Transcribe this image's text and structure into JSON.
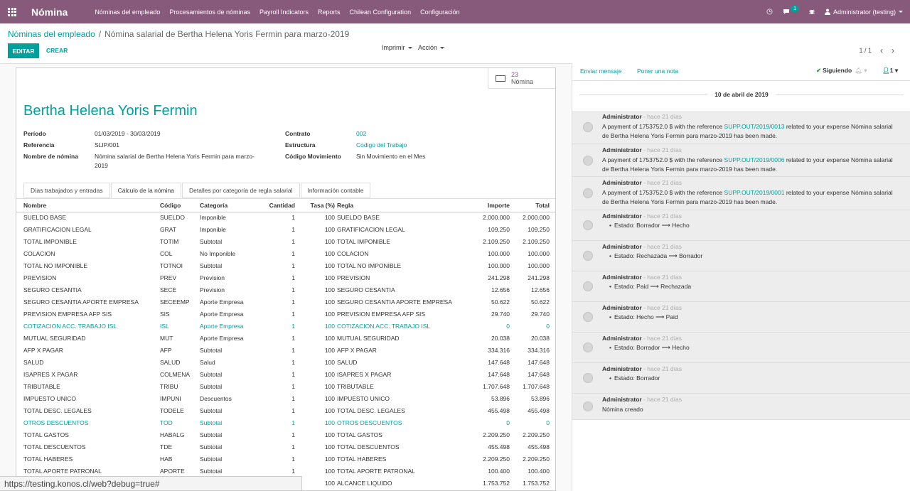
{
  "topbar": {
    "app_title": "Nómina",
    "menu": [
      "Nóminas del empleado",
      "Procesamientos de nóminas",
      "Payroll Indicators",
      "Reports",
      "Chilean Configuration",
      "Configuración"
    ],
    "message_count": "1",
    "user": "Administrator (testing)"
  },
  "breadcrumb": {
    "parent": "Nóminas del empleado",
    "separator": "/",
    "current": "Nómina salarial de Bertha Helena Yoris Fermin para marzo-2019"
  },
  "actions": {
    "edit": "EDITAR",
    "create": "CREAR",
    "print": "Imprimir",
    "action": "Acción",
    "pager": "1 / 1"
  },
  "smart_button": {
    "count": "23",
    "label": "Nómina"
  },
  "form": {
    "employee": "Bertha Helena Yoris Fermin",
    "period_label": "Período",
    "period": "01/03/2019 - 30/03/2019",
    "reference_label": "Referencia",
    "reference": "SLIP/001",
    "name_label": "Nombre de nómina",
    "name_line1": "Nómina salarial de Bertha Helena Yoris Fermin para marzo-",
    "name_line2": "2019",
    "contract_label": "Contrato",
    "contract": "002",
    "structure_label": "Estructura",
    "structure": "Codigo del Trabajo",
    "movement_label": "Código Movimiento",
    "movement": "Sin Movimiento en el Mes"
  },
  "tabs": [
    "Días trabajados y entradas",
    "Cálculo de la nómina",
    "Detalles por categoría de regla salarial",
    "Información contable"
  ],
  "table": {
    "headers": [
      "Nombre",
      "Código",
      "Categoría",
      "Cantidad",
      "Tasa (%)",
      "Regla",
      "Importe",
      "Total"
    ],
    "rows": [
      [
        "SUELDO BASE",
        "SUELDO",
        "Imponible",
        "1",
        "100",
        "SUELDO BASE",
        "2.000.000",
        "2.000.000"
      ],
      [
        "GRATIFICACION LEGAL",
        "GRAT",
        "Imponible",
        "1",
        "100",
        "GRATIFICACION LEGAL",
        "109.250",
        "109.250"
      ],
      [
        "TOTAL IMPONIBLE",
        "TOTIM",
        "Subtotal",
        "1",
        "100",
        "TOTAL IMPONIBLE",
        "2.109.250",
        "2.109.250"
      ],
      [
        "COLACION",
        "COL",
        "No Imponible",
        "1",
        "100",
        "COLACION",
        "100.000",
        "100.000"
      ],
      [
        "TOTAL NO IMPONIBLE",
        "TOTNOI",
        "Subtotal",
        "1",
        "100",
        "TOTAL NO IMPONIBLE",
        "100.000",
        "100.000"
      ],
      [
        "PREVISION",
        "PREV",
        "Prevision",
        "1",
        "100",
        "PREVISION",
        "241.298",
        "241.298"
      ],
      [
        "SEGURO CESANTIA",
        "SECE",
        "Prevision",
        "1",
        "100",
        "SEGURO CESANTIA",
        "12.656",
        "12.656"
      ],
      [
        "SEGURO CESANTIA APORTE EMPRESA",
        "SECEEMP",
        "Aporte Empresa",
        "1",
        "100",
        "SEGURO CESANTIA APORTE EMPRESA",
        "50.622",
        "50.622"
      ],
      [
        "PREVISION EMPRESA AFP SIS",
        "SIS",
        "Aporte Empresa",
        "1",
        "100",
        "PREVISION EMPRESA AFP SIS",
        "29.740",
        "29.740"
      ],
      [
        "COTIZACION ACC. TRABAJO ISL",
        "ISL",
        "Aporte Empresa",
        "1",
        "100",
        "COTIZACION ACC. TRABAJO ISL",
        "0",
        "0"
      ],
      [
        "MUTUAL SEGURIDAD",
        "MUT",
        "Aporte Empresa",
        "1",
        "100",
        "MUTUAL SEGURIDAD",
        "20.038",
        "20.038"
      ],
      [
        "AFP X PAGAR",
        "AFP",
        "Subtotal",
        "1",
        "100",
        "AFP X PAGAR",
        "334.316",
        "334.316"
      ],
      [
        "SALUD",
        "SALUD",
        "Salud",
        "1",
        "100",
        "SALUD",
        "147.648",
        "147.648"
      ],
      [
        "ISAPRES X PAGAR",
        "COLMENA",
        "Subtotal",
        "1",
        "100",
        "ISAPRES X PAGAR",
        "147.648",
        "147.648"
      ],
      [
        "TRIBUTABLE",
        "TRIBU",
        "Subtotal",
        "1",
        "100",
        "TRIBUTABLE",
        "1.707.648",
        "1.707.648"
      ],
      [
        "IMPUESTO UNICO",
        "IMPUNI",
        "Descuentos",
        "1",
        "100",
        "IMPUESTO UNICO",
        "53.896",
        "53.896"
      ],
      [
        "TOTAL DESC. LEGALES",
        "TODELE",
        "Subtotal",
        "1",
        "100",
        "TOTAL DESC. LEGALES",
        "455.498",
        "455.498"
      ],
      [
        "OTROS DESCUENTOS",
        "TOD",
        "Subtotal",
        "1",
        "100",
        "OTROS DESCUENTOS",
        "0",
        "0"
      ],
      [
        "TOTAL GASTOS",
        "HABALG",
        "Subtotal",
        "1",
        "100",
        "TOTAL GASTOS",
        "2.209.250",
        "2.209.250"
      ],
      [
        "TOTAL DESCUENTOS",
        "TDE",
        "Subtotal",
        "1",
        "100",
        "TOTAL DESCUENTOS",
        "455.498",
        "455.498"
      ],
      [
        "TOTAL HABERES",
        "HAB",
        "Subtotal",
        "1",
        "100",
        "TOTAL HABERES",
        "2.209.250",
        "2.209.250"
      ],
      [
        "TOTAL APORTE PATRONAL",
        "APORTE",
        "Subtotal",
        "1",
        "100",
        "TOTAL APORTE PATRONAL",
        "100.400",
        "100.400"
      ],
      [
        "",
        "",
        "",
        "",
        "100",
        "ALCANCE LIQUIDO",
        "1.753.752",
        "1.753.752"
      ]
    ],
    "link_rows": [
      9,
      17
    ]
  },
  "status_url": "https://testing.konos.cl/web?debug=true#",
  "chatter": {
    "send_message": "Enviar mensaje",
    "log_note": "Poner una nota",
    "following": "Siguiendo",
    "followers": "1",
    "date": "10 de abril de 2019",
    "messages": [
      {
        "author": "Administrator",
        "ago": "- hace 21 días",
        "pre": "A payment of 1753752.0 $ with the reference ",
        "ref": "SUPP.OUT/2019/0013",
        "post": " related to your expense Nómina salarial de Bertha Helena Yoris Fermin para marzo-2019 has been made."
      },
      {
        "author": "Administrator",
        "ago": "- hace 21 días",
        "pre": "A payment of 1753752.0 $ with the reference ",
        "ref": "SUPP.OUT/2019/0006",
        "post": " related to your expense Nómina salarial de Bertha Helena Yoris Fermin para marzo-2019 has been made."
      },
      {
        "author": "Administrator",
        "ago": "- hace 21 días",
        "pre": "A payment of 1753752.0 $ with the reference ",
        "ref": "SUPP.OUT/2019/0001",
        "post": " related to your expense Nómina salarial de Bertha Helena Yoris Fermin para marzo-2019 has been made."
      }
    ],
    "tracking": [
      {
        "author": "Administrator",
        "ago": "- hace 21 días",
        "text": "Estado: Borrador ⟶ Hecho"
      },
      {
        "author": "Administrator",
        "ago": "- hace 21 días",
        "text": "Estado: Rechazada ⟶ Borrador"
      },
      {
        "author": "Administrator",
        "ago": "- hace 21 días",
        "text": "Estado: Paid ⟶ Rechazada"
      },
      {
        "author": "Administrator",
        "ago": "- hace 21 días",
        "text": "Estado: Hecho ⟶ Paid"
      },
      {
        "author": "Administrator",
        "ago": "- hace 21 días",
        "text": "Estado: Borrador ⟶ Hecho"
      },
      {
        "author": "Administrator",
        "ago": "- hace 21 días",
        "text": "Estado: Borrador"
      }
    ],
    "created": {
      "author": "Administrator",
      "ago": "- hace 21 días",
      "text": "Nómina creado"
    }
  },
  "colors": {
    "brand": "#875a7b",
    "accent": "#00a09d"
  }
}
